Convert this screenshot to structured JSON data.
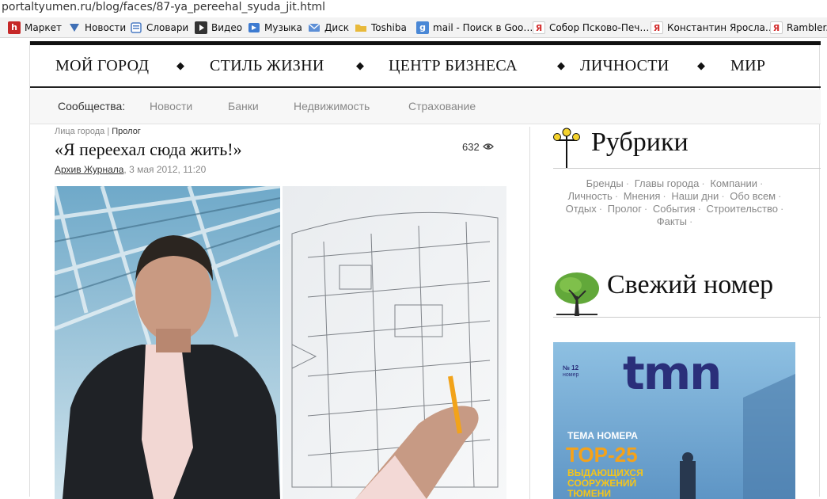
{
  "browser": {
    "url": "portaltyumen.ru/blog/faces/87-ya_pereehal_syuda_jit.html",
    "bookmarks": [
      {
        "label": "Маркет",
        "icon": "h-icon",
        "color": "#c62828"
      },
      {
        "label": "Новости",
        "icon": "news-icon",
        "color": "#3f6fb5"
      },
      {
        "label": "Словари",
        "icon": "dictionary-icon",
        "color": "#4c7cc4"
      },
      {
        "label": "Видео",
        "icon": "video-icon",
        "color": "#333333"
      },
      {
        "label": "Музыка",
        "icon": "music-icon",
        "color": "#3d7bd1"
      },
      {
        "label": "Диск",
        "icon": "disk-icon",
        "color": "#5d8fd6"
      },
      {
        "label": "Toshiba",
        "icon": "folder-icon",
        "color": "#e8b93a"
      },
      {
        "label": "mail - Поиск в Goo…",
        "icon": "google-icon",
        "color": "#4a88d6"
      },
      {
        "label": "Собор Псково-Печ…",
        "icon": "yandex-icon",
        "color": "#d32f2f"
      },
      {
        "label": "Константин Яросла…",
        "icon": "yandex-icon",
        "color": "#d32f2f"
      },
      {
        "label": "Rambler.r",
        "icon": "yandex-icon",
        "color": "#d32f2f"
      }
    ]
  },
  "nav": {
    "items": [
      "МОЙ ГОРОД",
      "СТИЛЬ ЖИЗНИ",
      "ЦЕНТР БИЗНЕСА",
      "ЛИЧНОСТИ",
      "МИР"
    ],
    "separator": "◆"
  },
  "subnav": {
    "label": "Сообщества:",
    "items": [
      "Новости",
      "Банки",
      "Недвижимость",
      "Страхование"
    ]
  },
  "article": {
    "breadcrumb_section": "Лица города",
    "breadcrumb_sep": "|",
    "breadcrumb_current": "Пролог",
    "title": "«Я переехал сюда жить!»",
    "views": "632",
    "author": "Архив Журнала",
    "date": ", 3 мая 2012, 11:20"
  },
  "sidebar": {
    "rubrics_title": "Рубрики",
    "tags": [
      "Бренды",
      "Главы города",
      "Компании",
      "Личность",
      "Мнения",
      "Наши дни",
      "Обо всем",
      "Отдых",
      "Пролог",
      "События",
      "Строительство",
      "Факты"
    ],
    "tag_separator": "·",
    "issue_title": "Свежий номер",
    "cover": {
      "logo": "tmn",
      "issue_label": "№ 12",
      "issue_sub": "номер",
      "theme": "ТЕМА НОМЕРА",
      "headline": "TOP-25",
      "sub1": "ВЫДАЮЩИХСЯ",
      "sub2": "СООРУЖЕНИЙ",
      "sub3": "ТЮМЕНИ"
    }
  }
}
